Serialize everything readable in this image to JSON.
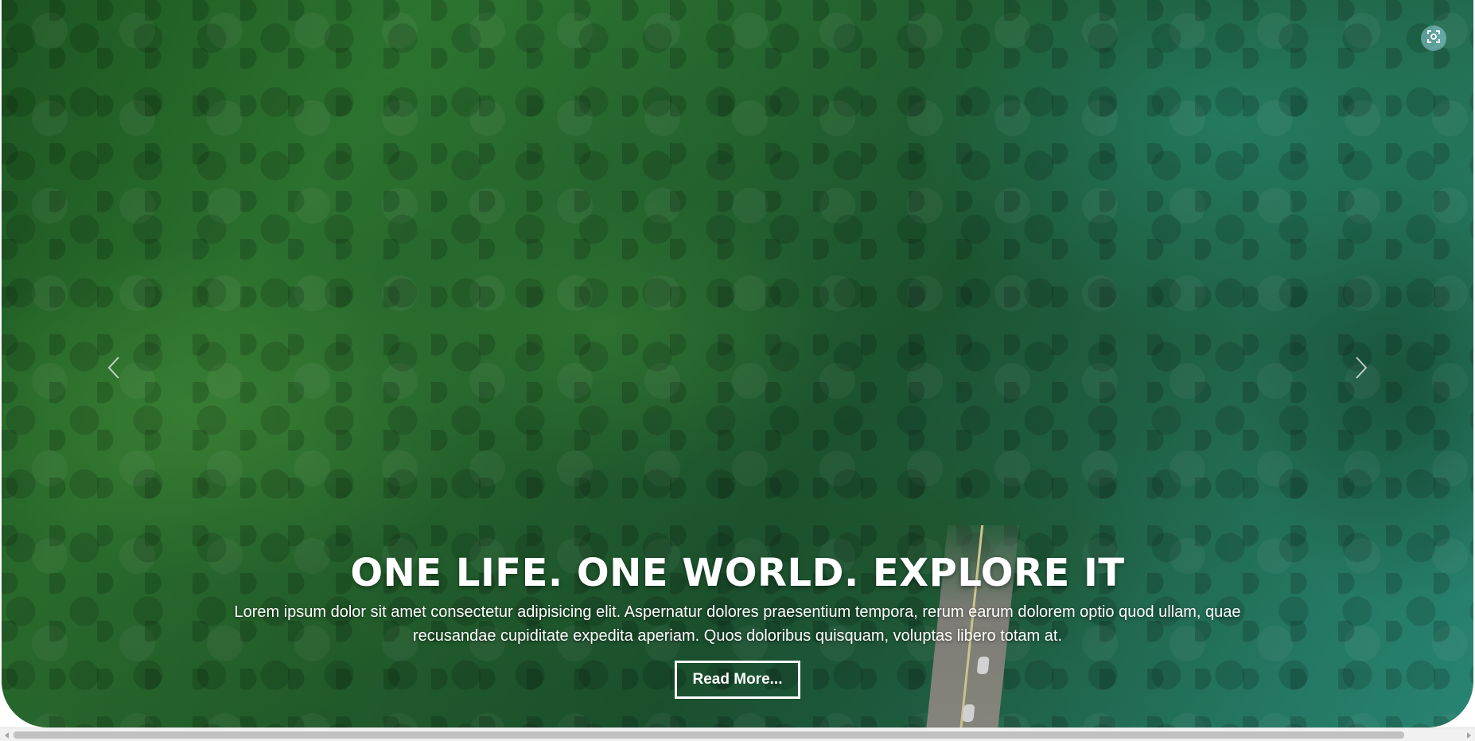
{
  "hero": {
    "title": "ONE LIFE. ONE WORLD. EXPLORE IT",
    "description": "Lorem ipsum dolor sit amet consectetur adipisicing elit. Aspernatur dolores praesentium tempora, rerum earum dolorem optio quod ullam, quae recusandae cupiditate expedita aperiam. Quos doloribus quisquam, voluptas libero totam at.",
    "button_label": "Read More...",
    "background_image": "forest hillside with road",
    "prev_icon": "chevron-left-icon",
    "next_icon": "chevron-right-icon",
    "lens_icon": "visual-search-icon"
  },
  "colors": {
    "text": "#ffffff",
    "forest_dark": "#1d5a22",
    "forest_teal": "#2e9a84",
    "scrollbar_track": "#f1f1f1",
    "scrollbar_thumb": "#c1c1c1"
  },
  "scrollbar": {
    "orientation": "horizontal",
    "left_icon": "scroll-left-icon",
    "right_icon": "scroll-right-icon"
  }
}
